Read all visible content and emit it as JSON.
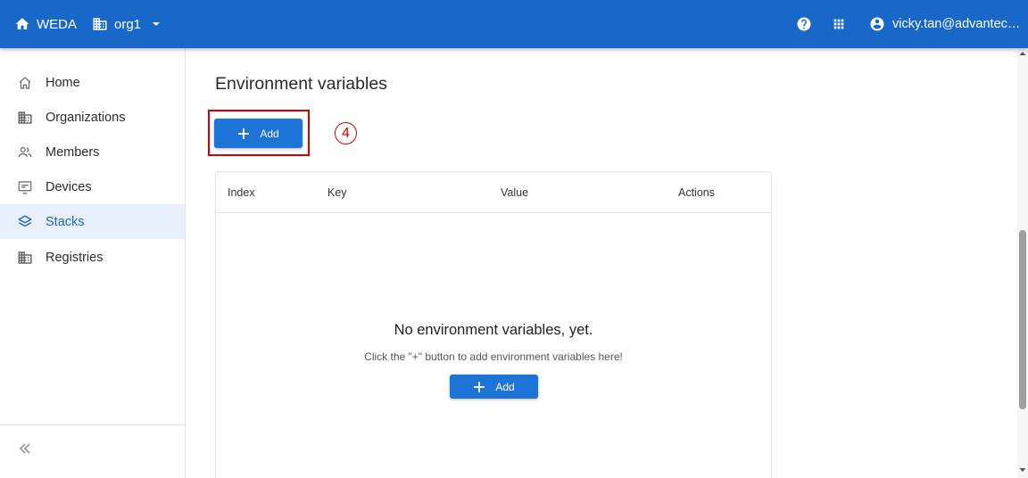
{
  "header": {
    "brand": "WEDA",
    "org": "org1",
    "user": "vicky.tan@advantec…",
    "bg_color": "#1967c8"
  },
  "sidebar": {
    "items": [
      {
        "label": "Home",
        "icon": "home-outline-icon"
      },
      {
        "label": "Organizations",
        "icon": "building-icon"
      },
      {
        "label": "Members",
        "icon": "people-icon"
      },
      {
        "label": "Devices",
        "icon": "device-icon"
      },
      {
        "label": "Stacks",
        "icon": "layers-icon",
        "active": true
      },
      {
        "label": "Registries",
        "icon": "building-icon"
      }
    ],
    "collapse_icon": "double-chevron-left-icon"
  },
  "main": {
    "title": "Environment variables",
    "add_label": "Add",
    "step_badge": "4",
    "table": {
      "columns": [
        "Index",
        "Key",
        "Value",
        "Actions"
      ],
      "empty_title": "No environment variables, yet.",
      "empty_subtitle": "Click the \"+\" button to add environment variables here!",
      "empty_add_label": "Add"
    }
  },
  "colors": {
    "accent": "#1c74d6",
    "highlight": "#d40000",
    "active_bg": "#e8f0fc"
  }
}
